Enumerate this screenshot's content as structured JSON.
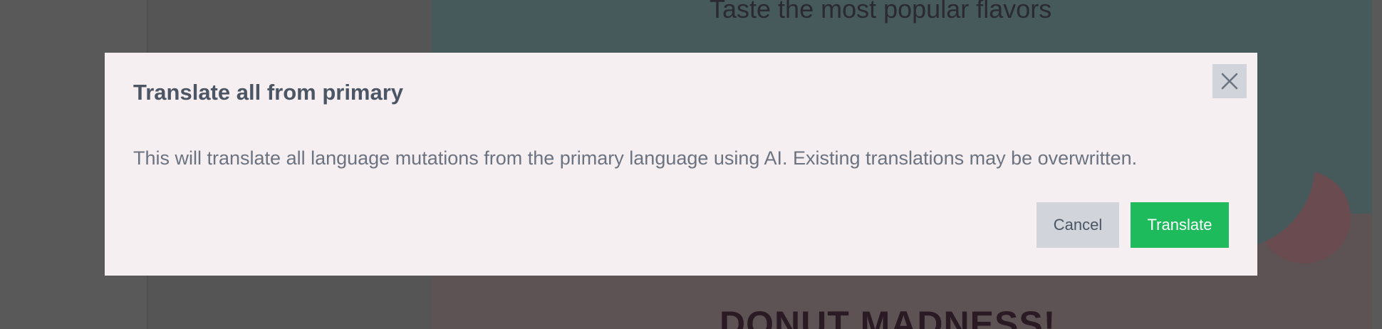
{
  "background": {
    "heading": "Taste the most popular flavors",
    "title": "DONUT MADNESS!"
  },
  "modal": {
    "title": "Translate all from primary",
    "message": "This will translate all language mutations from the primary language using AI. Existing translations may be overwritten.",
    "close_icon": "close-icon",
    "cancel_label": "Cancel",
    "confirm_label": "Translate"
  },
  "colors": {
    "primary_button": "#1dbb5c",
    "secondary_button": "#d1d5db",
    "modal_background": "#f5eff1",
    "overlay": "#5a5a5a"
  }
}
